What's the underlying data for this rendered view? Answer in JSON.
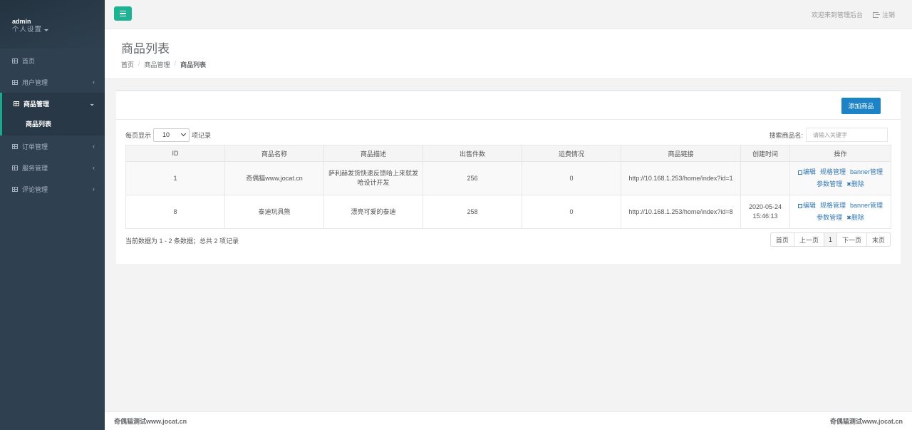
{
  "sidebar": {
    "user_name": "admin",
    "settings_label": "个人设置",
    "items": [
      {
        "label": "首页",
        "chevron": ""
      },
      {
        "label": "用户管理",
        "chevron": "‹"
      },
      {
        "label": "商品管理",
        "chevron": "⌄",
        "sub": "商品列表"
      },
      {
        "label": "订单管理",
        "chevron": "‹"
      },
      {
        "label": "服务管理",
        "chevron": "‹"
      },
      {
        "label": "评论管理",
        "chevron": "‹"
      }
    ]
  },
  "topbar": {
    "welcome": "欢迎来到管理后台",
    "logout": "注销"
  },
  "heading": {
    "title": "商品列表",
    "breadcrumb": [
      "首页",
      "商品管理",
      "商品列表"
    ]
  },
  "toolbar": {
    "add_label": "添加商品",
    "length_prefix": "每页显示",
    "length_value": "10",
    "length_suffix": "项记录",
    "search_label": "搜索商品名:",
    "search_placeholder": "请输入关键字"
  },
  "table": {
    "headers": [
      "ID",
      "商品名称",
      "商品描述",
      "出售件数",
      "运费情况",
      "商品链接",
      "创建时间",
      "操作"
    ],
    "rows": [
      {
        "id": "1",
        "name": "奇偶猫www.jocat.cn",
        "desc": "萨利赫发货快速反馈哈上来就发哈设计开发",
        "sold": "256",
        "freight": "0",
        "link": "http://10.168.1.253/home/index?id=1",
        "created": ""
      },
      {
        "id": "8",
        "name": "泰迪玩具熊",
        "desc": "漂亮可爱的泰迪",
        "sold": "258",
        "freight": "0",
        "link": "http://10.168.1.253/home/index?id=8",
        "created": "2020-05-24 15:46:13"
      }
    ],
    "ops": {
      "edit": "编辑",
      "spec": "规格管理",
      "banner": "banner管理",
      "param": "参数管理",
      "delete": "删除"
    }
  },
  "info": "当前数据为 1 - 2 条数据；总共 2 项记录",
  "pager": {
    "first": "首页",
    "prev": "上一页",
    "current": "1",
    "next": "下一页",
    "last": "末页"
  },
  "footer": {
    "left": "奇偶猫测试www.jocat.cn",
    "right": "奇偶猫测试www.jocat.cn"
  },
  "colors": {
    "sidebar": "#2f4050",
    "accent": "#1ab394",
    "primary": "#1c84c6",
    "link": "#337ab7"
  }
}
